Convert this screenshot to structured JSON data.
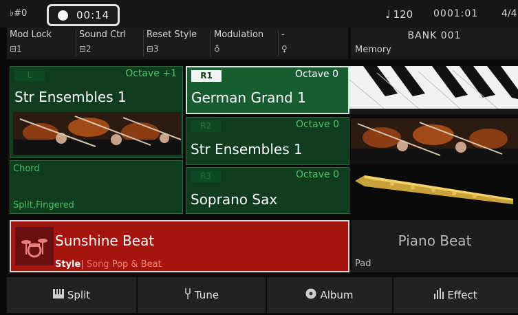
{
  "status": {
    "key": "♭#0",
    "record_time": "00:14",
    "tempo_note": "♩",
    "tempo": "120",
    "measure": "0001:01",
    "beat": "4/4"
  },
  "controls": [
    {
      "label": "Mod Lock",
      "value": "⊟1"
    },
    {
      "label": "Sound Ctrl",
      "value": "⊟2"
    },
    {
      "label": "Reset Style",
      "value": "⊟3"
    },
    {
      "label": "Modulation",
      "value": "♁"
    },
    {
      "label": "-",
      "value": "♀"
    }
  ],
  "bank": {
    "title": "BANK 001",
    "memory_label": "Memory"
  },
  "parts": {
    "left": {
      "badge": "L",
      "octave": "Octave +1",
      "voice": "Str Ensembles 1"
    },
    "r1": {
      "badge": "R1",
      "octave": "Octave 0",
      "voice": "German Grand 1"
    },
    "r2": {
      "badge": "R2",
      "octave": "Octave 0",
      "voice": "Str Ensembles 1"
    },
    "r3": {
      "badge": "R3",
      "octave": "Octave 0",
      "voice": "Soprano Sax"
    }
  },
  "chord": {
    "title": "Chord",
    "mode": "Split,Fingered"
  },
  "style": {
    "name": "Sunshine Beat",
    "tab_style": "Style",
    "tab_sep": "|",
    "tab_song": "Song",
    "genre": "Pop & Beat"
  },
  "pad": {
    "name": "Piano Beat",
    "label": "Pad"
  },
  "bottom_buttons": [
    {
      "label": "Split",
      "icon": "keyboard-icon"
    },
    {
      "label": "Tune",
      "icon": "tuning-fork-icon"
    },
    {
      "label": "Album",
      "icon": "disc-icon"
    },
    {
      "label": "Effect",
      "icon": "equalizer-icon"
    }
  ],
  "colors": {
    "panel_green": "#0f3d1e",
    "active_green": "#185d2f",
    "accent_green": "#4fc46e",
    "style_red": "#a5140f"
  }
}
